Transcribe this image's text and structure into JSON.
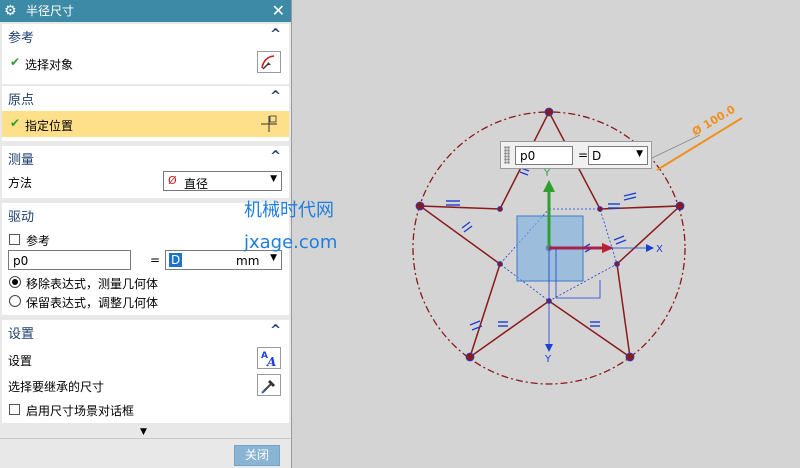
{
  "dialog": {
    "title": "半径尺寸",
    "sections": {
      "reference": {
        "label": "参考",
        "select_object": "选择对象"
      },
      "origin": {
        "label": "原点",
        "specify_location": "指定位置"
      },
      "measure": {
        "label": "测量",
        "method_label": "方法",
        "method_value": "直径"
      },
      "drive": {
        "label": "驱动",
        "reference_checkbox": "参考",
        "name_value": "p0",
        "equals": "=",
        "expr_value": "D",
        "unit": "mm",
        "option1": "移除表达式，测量几何体",
        "option2": "保留表达式，调整几何体"
      },
      "settings": {
        "label": "设置",
        "settings_label": "设置",
        "inherit_label": "选择要继承的尺寸",
        "enable_dialog": "启用尺寸场景对话框"
      }
    },
    "close_button": "关闭"
  },
  "watermark": {
    "line1": "机械时代网",
    "line2": "jxage.com"
  },
  "canvas": {
    "float_name": "p0",
    "float_equals": "=",
    "float_value": "D",
    "dimension_text": "Ø 100.0",
    "axis_x": "X",
    "axis_y": "Y",
    "axis_y2": "Y",
    "axis_x2": "X"
  },
  "colors": {
    "titlebar": "#3d8aa6",
    "highlight_row": "#ffe08a",
    "star": "#8b1a1a",
    "constraint": "#1a3fd6",
    "dimension": "#f0901e"
  }
}
